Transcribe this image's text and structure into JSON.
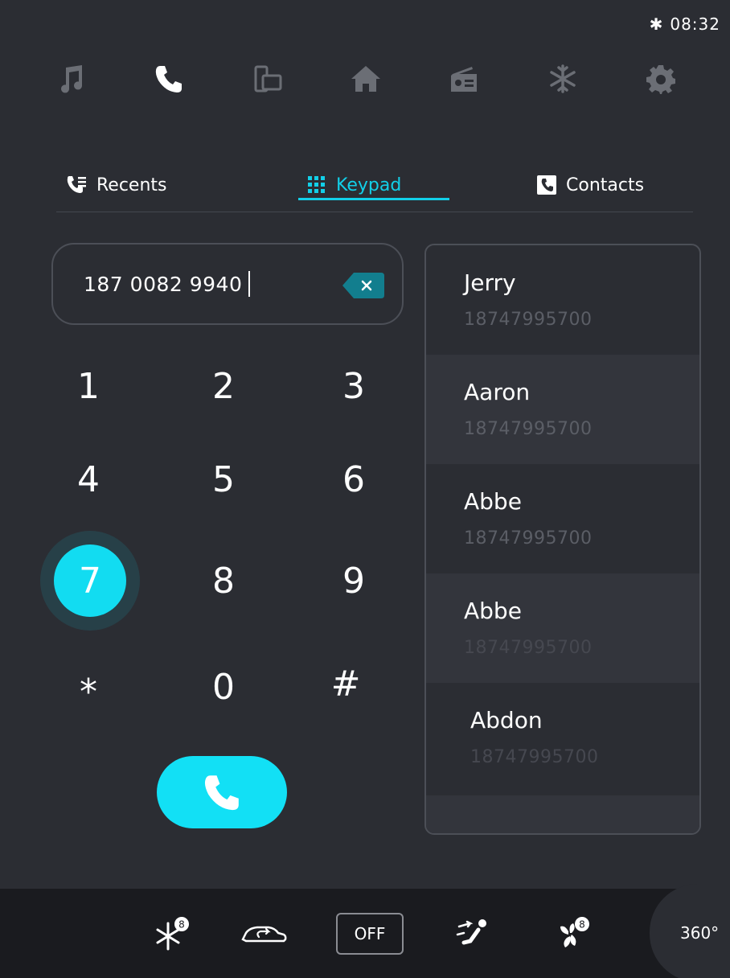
{
  "status": {
    "bluetooth_icon": "bluetooth-icon",
    "time": "08:32"
  },
  "top_nav": {
    "items": [
      {
        "icon": "music-icon",
        "active": false
      },
      {
        "icon": "phone-icon",
        "active": true
      },
      {
        "icon": "mirror-screen-icon",
        "active": false
      },
      {
        "icon": "home-icon",
        "active": false
      },
      {
        "icon": "radio-icon",
        "active": false
      },
      {
        "icon": "climate-icon",
        "active": false
      },
      {
        "icon": "settings-icon",
        "active": false
      }
    ]
  },
  "tabs": {
    "recents": "Recents",
    "keypad": "Keypad",
    "contacts": "Contacts",
    "active": "keypad"
  },
  "dialer": {
    "number": "187 0082 9940",
    "keys": [
      "1",
      "2",
      "3",
      "4",
      "5",
      "6",
      "7",
      "8",
      "9",
      "*",
      "0",
      "#"
    ],
    "pressed_key": "7"
  },
  "contacts": [
    {
      "name": "Jerry",
      "number": "18747995700"
    },
    {
      "name": "Aaron",
      "number": "18747995700"
    },
    {
      "name": "Abbe",
      "number": "18747995700"
    },
    {
      "name": "Abbe",
      "number": "18747995700"
    },
    {
      "name": "Abdon",
      "number": "18747995700"
    }
  ],
  "bottom_bar": {
    "front_defrost_level": "8",
    "fan_level": "8",
    "off_label": "OFF",
    "view_label": "360°"
  },
  "colors": {
    "accent": "#12cfe8",
    "background": "#2b2d33",
    "bottom_bar": "#1a1b1f",
    "muted_text": "#5b5e66"
  }
}
